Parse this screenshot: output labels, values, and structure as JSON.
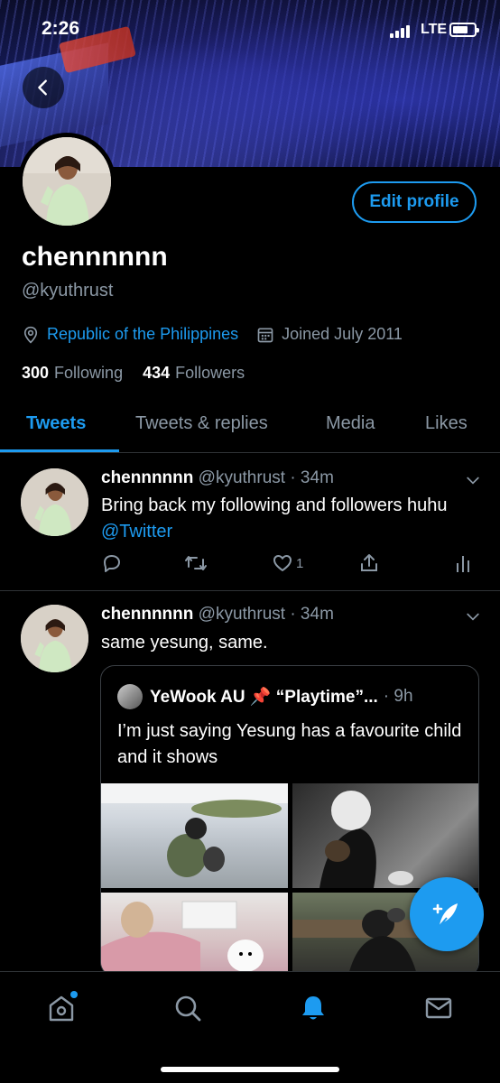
{
  "status_bar": {
    "time": "2:26",
    "network": "LTE"
  },
  "profile": {
    "display_name": "chennnnnn",
    "handle": "@kyuthrust",
    "edit_label": "Edit profile",
    "location": "Republic of the Philippines",
    "joined": "Joined July 2011",
    "following_count": "300",
    "following_label": "Following",
    "followers_count": "434",
    "followers_label": "Followers"
  },
  "tabs": [
    {
      "label": "Tweets",
      "active": true
    },
    {
      "label": "Tweets & replies",
      "active": false
    },
    {
      "label": "Media",
      "active": false
    },
    {
      "label": "Likes",
      "active": false
    }
  ],
  "tweets": [
    {
      "name": "chennnnnn",
      "meta": "@kyuthrust · 34m",
      "text_before": "Bring back my following and followers huhu ",
      "mention": "@Twitter",
      "like_count": "1"
    },
    {
      "name": "chennnnnn",
      "meta": "@kyuthrust · 34m",
      "text": "same yesung, same.",
      "quote": {
        "name": "YeWook AU 📌 “Playtime”...",
        "time": "· 9h",
        "text": "I’m just saying Yesung has a favourite child and it shows"
      }
    }
  ],
  "icons": {
    "back": "chevron-left-icon",
    "location": "location-pin-icon",
    "calendar": "calendar-icon",
    "compose": "compose-feather-icon",
    "nav": [
      "home-icon",
      "search-icon",
      "notifications-bell-icon",
      "messages-envelope-icon"
    ]
  },
  "colors": {
    "accent": "#1d9bf0",
    "muted": "#8b98a5",
    "background": "#000000"
  }
}
